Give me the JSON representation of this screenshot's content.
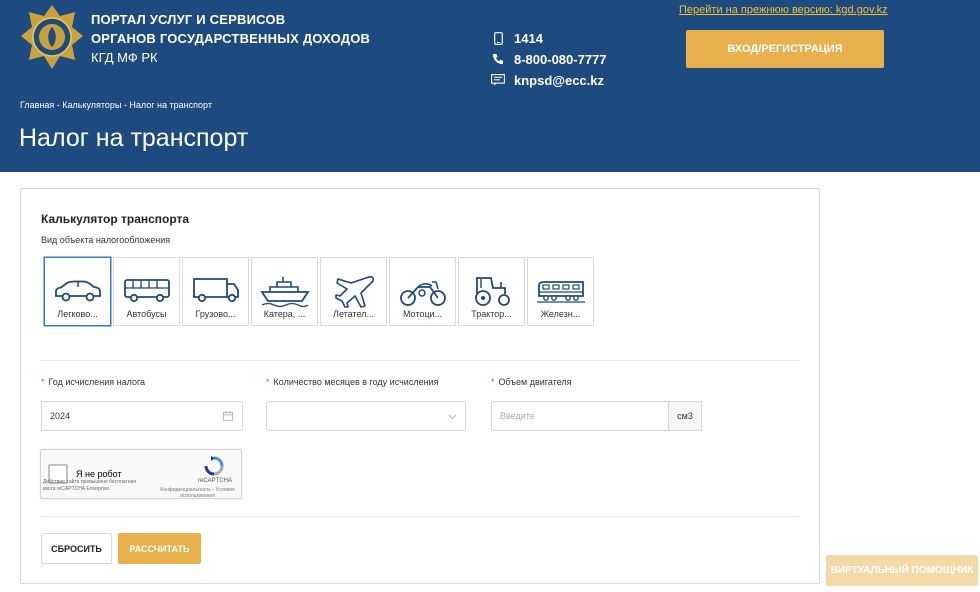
{
  "header": {
    "org_line1": "ПОРТАЛ УСЛУГ И СЕРВИСОВ",
    "org_line2": "ОРГАНОВ ГОСУДАРСТВЕННЫХ ДОХОДОВ",
    "org_line3": "КГД МФ РК",
    "phone_short": "1414",
    "phone_long": "8-800-080-7777",
    "email": "knpsd@ecc.kz",
    "old_version_link": "Перейти на прежнюю версию: kgd.gov.kz",
    "login_button": "ВХОД/РЕГИСТРАЦИЯ",
    "breadcrumb": "Главная - Калькуляторы - Налог на транспорт",
    "page_title": "Налог на транспорт"
  },
  "calculator": {
    "title": "Калькулятор транспорта",
    "subtitle": "Вид объекта налогообложения",
    "types": [
      {
        "label": "Легково...",
        "icon": "car-icon",
        "selected": true
      },
      {
        "label": "Автобусы",
        "icon": "bus-icon",
        "selected": false
      },
      {
        "label": "Грузово...",
        "icon": "truck-icon",
        "selected": false
      },
      {
        "label": "Катера, ...",
        "icon": "ship-icon",
        "selected": false
      },
      {
        "label": "Летател...",
        "icon": "airplane-icon",
        "selected": false
      },
      {
        "label": "Мотоци...",
        "icon": "motorcycle-icon",
        "selected": false
      },
      {
        "label": "Трактор...",
        "icon": "tractor-icon",
        "selected": false
      },
      {
        "label": "Железн...",
        "icon": "train-icon",
        "selected": false
      }
    ],
    "fields": {
      "year_label": "Год исчисления налога",
      "year_value": "2024",
      "months_label": "Количество месяцев в году исчисления",
      "months_value": "",
      "engine_label": "Объем двигателя",
      "engine_placeholder": "Введите",
      "engine_unit": "см3"
    },
    "captcha": {
      "label": "Я не робот",
      "brand": "reCAPTCHA",
      "privacy": "Конфиденциальность - Условия использования",
      "note": "Действие сайта превышено бесплатная квота reCAPTCHA Enterprise."
    },
    "reset_button": "СБРОСИТЬ",
    "calculate_button": "РАССЧИТАТЬ"
  },
  "helper_button": "ВИРТУАЛЬНЫЙ ПОМОЩНИК",
  "colors": {
    "header_bg": "#1d4a7f",
    "accent": "#e8b14e",
    "link": "#f2c230",
    "selected_border": "#2f7bd6"
  }
}
